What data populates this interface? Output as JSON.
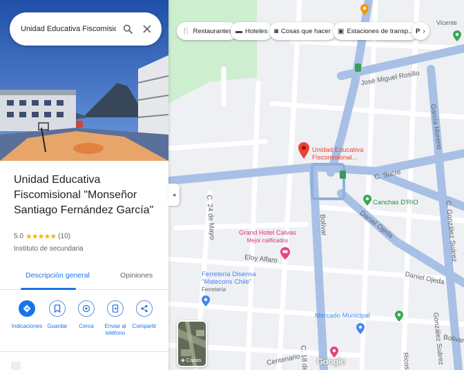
{
  "search": {
    "query": "Unidad Educativa Fiscomisional \"Mor"
  },
  "place": {
    "title": "Unidad Educativa Fiscomisional \"Monseñor Santiago Fernández García\"",
    "rating": "5.0",
    "reviews": "(10)",
    "category": "Instituto de secundaria"
  },
  "tabs": {
    "overview": "Descripción general",
    "reviews": "Opiniones"
  },
  "actions": [
    {
      "label": "Indicaciones",
      "icon": "directions-icon"
    },
    {
      "label": "Guardar",
      "icon": "bookmark-icon"
    },
    {
      "label": "Cerca",
      "icon": "nearby-icon"
    },
    {
      "label": "Enviar al teléfono",
      "icon": "send-to-phone-icon"
    },
    {
      "label": "Compartir",
      "icon": "share-icon"
    }
  ],
  "chips": [
    {
      "label": "Restaurantes",
      "icon": "restaurant-icon"
    },
    {
      "label": "Hoteles",
      "icon": "hotel-icon"
    },
    {
      "label": "Cosas que hacer",
      "icon": "camera-icon"
    },
    {
      "label": "Estaciones de transp...",
      "icon": "transit-icon"
    },
    {
      "label": "P",
      "icon": ""
    }
  ],
  "map": {
    "marker_label": "Unidad Educativa Fiscomisional...",
    "streets": {
      "jose_miguel": "José Miguel Rosillo",
      "garcia_moreno": "García Moreno",
      "sucre": "C. Sucre",
      "bolivar": "Bolívar",
      "daniel_ojeda": "Daniel Ojeda",
      "daniel_ojeda2": "Daniel Ojeda",
      "eloy_alfaro": "Eloy Alfaro",
      "gonzalez_suarez": "C. González Suárez",
      "gonzalez_suarez2": "González Suárez",
      "veinticuatro_mayo": "C. 24 de Mayo",
      "diez_agosto": "C. 18 de",
      "centenario": "Centenario",
      "bolivar2": "Bolivar",
      "ricos": "Ricos",
      "vicente": "Vicente"
    },
    "pois": {
      "canchas": "Canchas D'RIO",
      "hotel_name": "Grand Hotel Calvas",
      "hotel_sub": "Mejor calificados",
      "ferreteria": "Ferretería Disensa \"Matecons Chile\"",
      "ferreteria_sub": "Ferretería",
      "mercado": "Mercado Municipal"
    },
    "layers_label": "Capas",
    "brand": "Google"
  },
  "colors": {
    "accent": "#1a73e8",
    "marker": "#ea4335",
    "road_major": "#a8c0e6",
    "road_minor": "#ffffff",
    "park": "#cdeecf"
  }
}
